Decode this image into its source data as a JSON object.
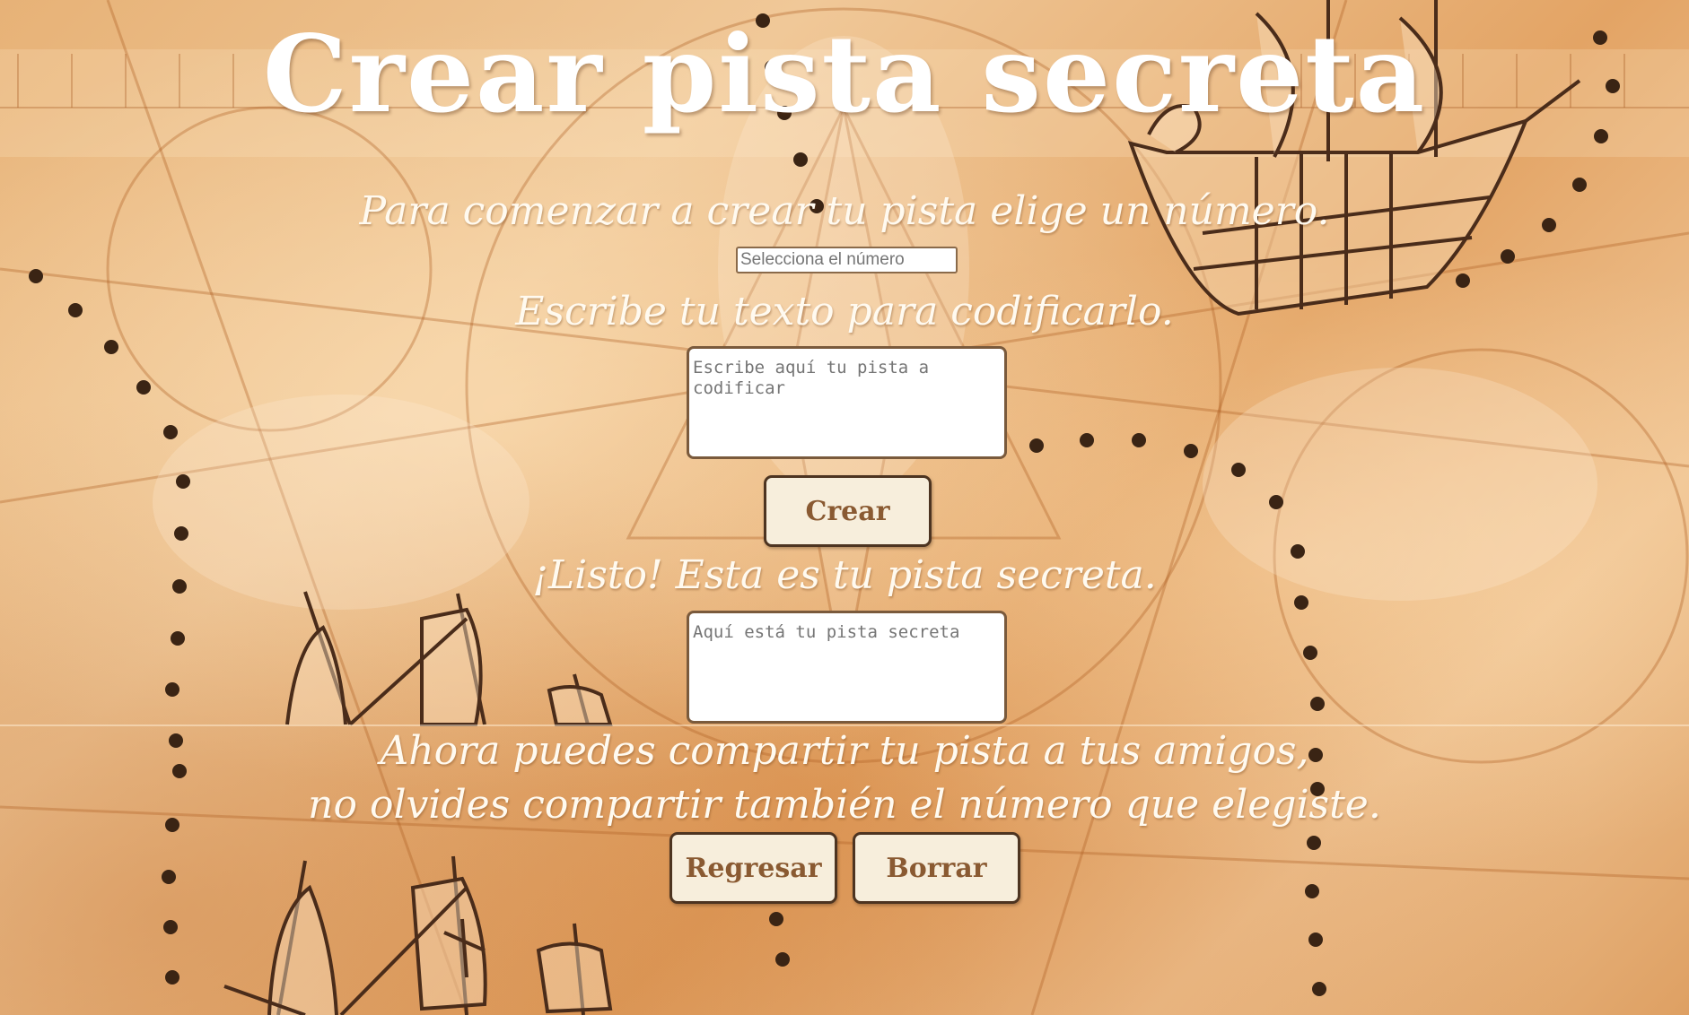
{
  "page": {
    "title": "Crear pista secreta"
  },
  "step_number": {
    "prompt": "Para comenzar a crear tu pista elige un número.",
    "input_placeholder": "Selecciona el número"
  },
  "step_text": {
    "prompt": "Escribe tu texto para codificarlo.",
    "input_placeholder": "Escribe aquí tu pista a codificar",
    "create_button": "Crear"
  },
  "result": {
    "prompt": "¡Listo! Esta es tu pista secreta.",
    "output_placeholder": "Aquí está tu pista secreta"
  },
  "share": {
    "line1": "Ahora puedes compartir tu pista a tus amigos,",
    "line2": "no olvides compartir también el número que elegiste.",
    "back_button": "Regresar",
    "clear_button": "Borrar"
  },
  "colors": {
    "parchment": "#e7b277",
    "button_bg": "#f7eedc",
    "button_text": "#8a5a32",
    "border": "#4d3421",
    "heading_text": "#ffffff"
  }
}
